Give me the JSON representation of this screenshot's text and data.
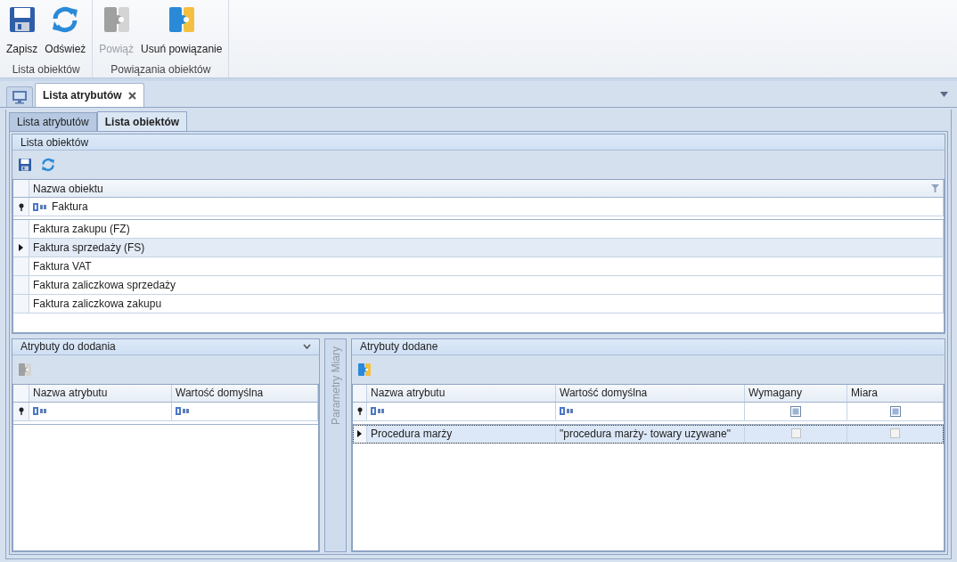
{
  "ribbon": {
    "groups": [
      {
        "label": "Lista obiektów",
        "buttons": [
          {
            "label": "Zapisz",
            "disabled": false
          },
          {
            "label": "Odśwież",
            "disabled": false
          }
        ]
      },
      {
        "label": "Powiązania obiektów",
        "buttons": [
          {
            "label": "Powiąż",
            "disabled": true
          },
          {
            "label": "Usuń powiązanie",
            "disabled": false
          }
        ]
      }
    ]
  },
  "document_tabs": [
    {
      "label": "Lista atrybutów",
      "selected": true,
      "closable": true
    }
  ],
  "tabs": [
    {
      "label": "Lista atrybutów",
      "selected": false
    },
    {
      "label": "Lista obiektów",
      "selected": true
    }
  ],
  "objects_panel": {
    "title": "Lista obiektów",
    "columns": [
      "Nazwa obiektu"
    ],
    "filter": "Faktura",
    "rows": [
      {
        "name": "Faktura zakupu (FZ)",
        "selected": false
      },
      {
        "name": "Faktura sprzedaży (FS)",
        "selected": true
      },
      {
        "name": "Faktura VAT",
        "selected": false
      },
      {
        "name": "Faktura zaliczkowa sprzedaży",
        "selected": false
      },
      {
        "name": "Faktura zaliczkowa zakupu",
        "selected": false
      }
    ]
  },
  "available_panel": {
    "title": "Atrybuty do dodania",
    "columns": [
      "Nazwa atrybutu",
      "Wartość domyślna"
    ]
  },
  "side_panel": {
    "title": "Parametry Miary"
  },
  "added_panel": {
    "title": "Atrybuty dodane",
    "columns": [
      "Nazwa atrybutu",
      "Wartość domyślna",
      "Wymagany",
      "Miara"
    ],
    "rows": [
      {
        "name": "Procedura marży",
        "default_value": "\"procedura marży- towary uzywane\"",
        "required": false,
        "measure": false,
        "selected": true
      }
    ]
  }
}
